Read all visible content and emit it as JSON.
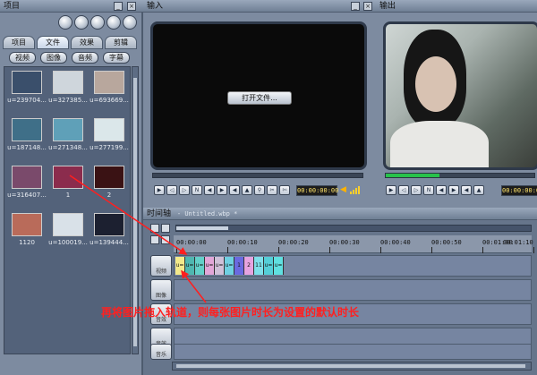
{
  "project_panel": {
    "title": "项目",
    "tabs": [
      "项目",
      "文件",
      "效果",
      "剪辑"
    ],
    "active_tab": "文件",
    "sub_buttons": [
      "视频",
      "图像",
      "音频",
      "字幕"
    ],
    "media": [
      {
        "label": "u=239704...",
        "color": "#3a4f6b"
      },
      {
        "label": "u=327385...",
        "color": "#cfd6dc"
      },
      {
        "label": "u=693669...",
        "color": "#b8a79d"
      },
      {
        "label": "u=187148...",
        "color": "#3f6f88"
      },
      {
        "label": "u=271348...",
        "color": "#5fa0b8"
      },
      {
        "label": "u=277199...",
        "color": "#dbe7ea"
      },
      {
        "label": "u=316407...",
        "color": "#7a4a6b"
      },
      {
        "label": "1",
        "color": "#8b2c4d"
      },
      {
        "label": "2",
        "color": "#3a1214"
      },
      {
        "label": "1120",
        "color": "#b96b5a"
      },
      {
        "label": "u=100019...",
        "color": "#d9e1e8"
      },
      {
        "label": "u=139444...",
        "color": "#1c2030"
      }
    ]
  },
  "input_panel": {
    "title": "输入",
    "open_file_button": "打开文件...",
    "timecode": "00:00:00:00"
  },
  "output_panel": {
    "title": "输出",
    "timecode": "00:00:00:00"
  },
  "timeline": {
    "title": "时间轴",
    "file_name": "- Untitled.wbp *",
    "ticks": [
      "00:00:00",
      "00:00:10",
      "00:00:20",
      "00:00:30",
      "00:00:40",
      "00:00:50",
      "00:01:00",
      "00:01:10"
    ],
    "clips": [
      {
        "label": "u=",
        "color": "#f3e98a"
      },
      {
        "label": "u=",
        "color": "#4fb7b0"
      },
      {
        "label": "u=",
        "color": "#63d0c9"
      },
      {
        "label": "u=",
        "color": "#e2a6d8"
      },
      {
        "label": "u=",
        "color": "#cfc0d8"
      },
      {
        "label": "u=",
        "color": "#6fd0e2"
      },
      {
        "label": "1",
        "color": "#6a6ae0"
      },
      {
        "label": "2",
        "color": "#e6a3e0"
      },
      {
        "label": "11",
        "color": "#7ee0ea"
      },
      {
        "label": "u=",
        "color": "#55cfd8"
      },
      {
        "label": "u=",
        "color": "#60e0e0"
      }
    ],
    "track_labels": [
      "视频",
      "图像",
      "音效",
      "音乐"
    ]
  },
  "annotation": "再将图片拖入轨道，则每张图片时长为设置的默认时长"
}
